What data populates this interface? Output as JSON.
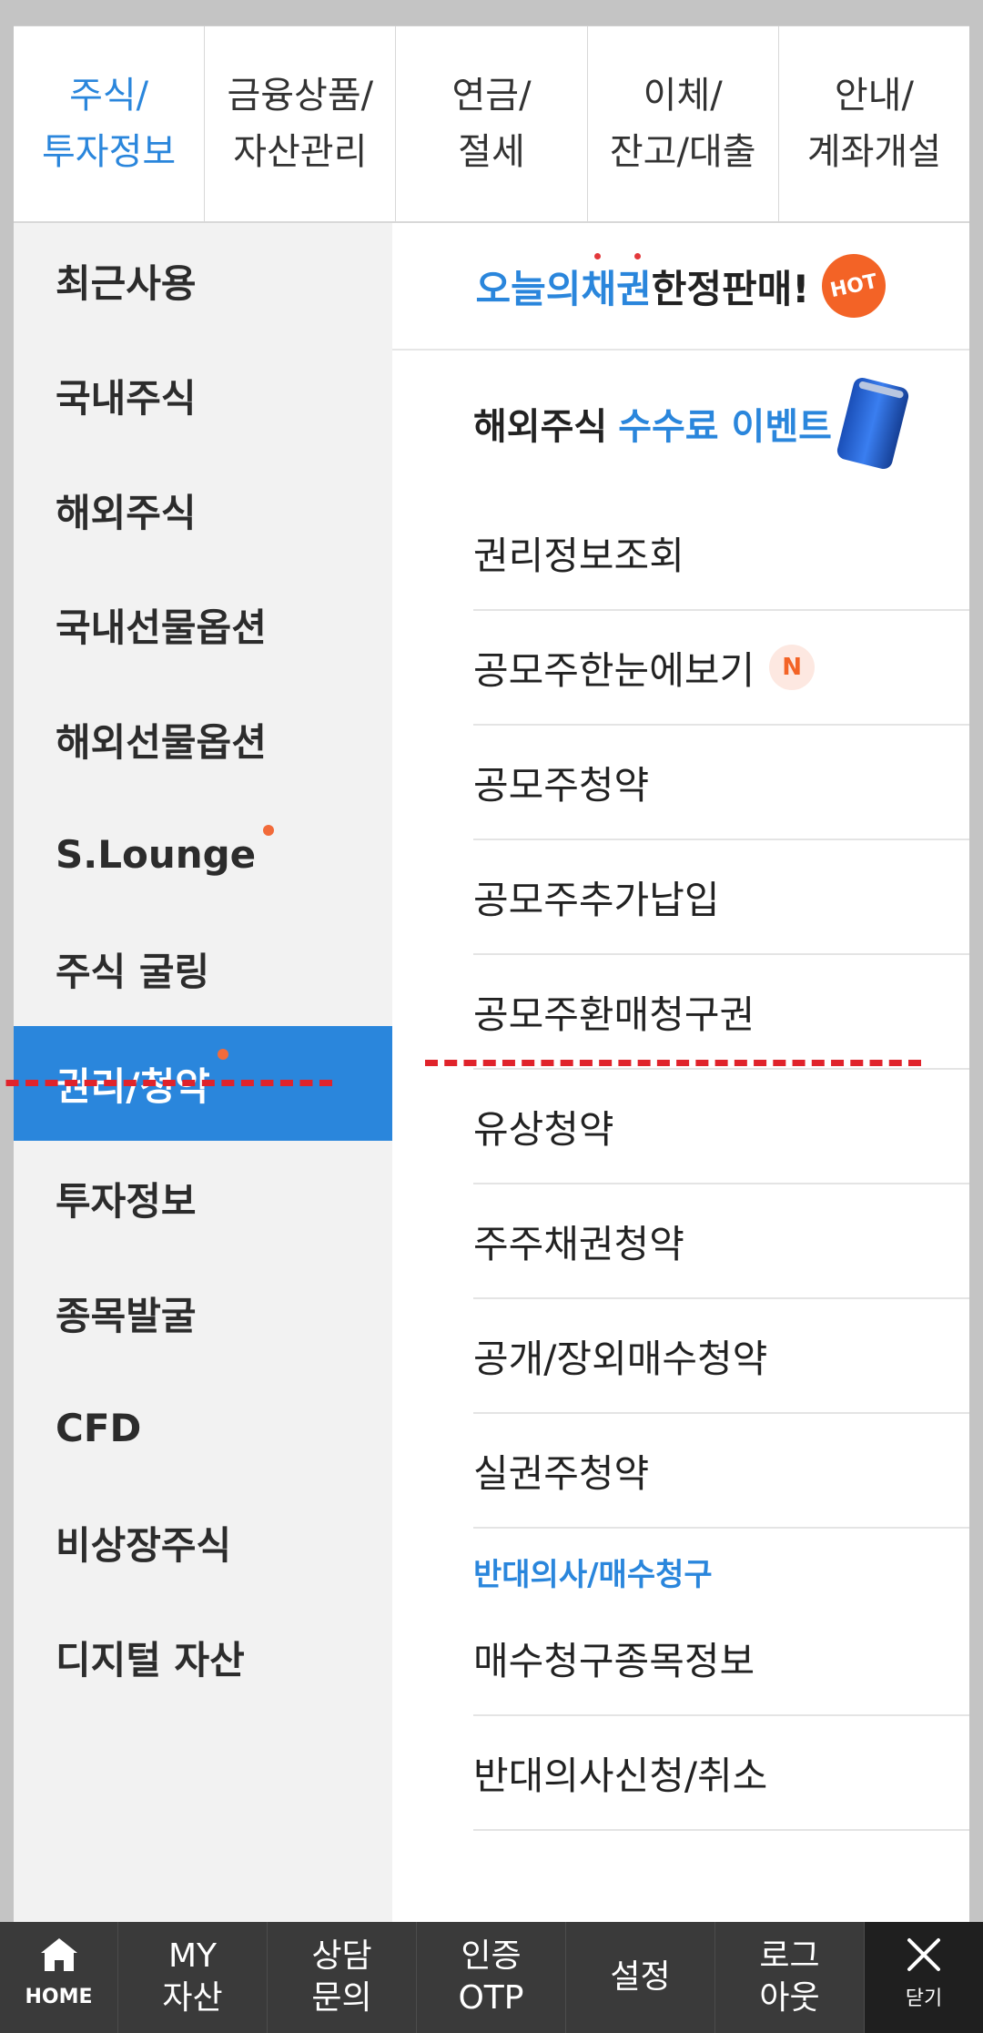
{
  "top_tabs": [
    {
      "line1": "주식/",
      "line2": "투자정보"
    },
    {
      "line1": "금융상품/",
      "line2": "자산관리"
    },
    {
      "line1": "연금/",
      "line2": "절세"
    },
    {
      "line1": "이체/",
      "line2": "잔고/대출"
    },
    {
      "line1": "안내/",
      "line2": "계좌개설"
    }
  ],
  "left_menu": [
    {
      "label": "최근사용"
    },
    {
      "label": "국내주식"
    },
    {
      "label": "해외주식"
    },
    {
      "label": "국내선물옵션"
    },
    {
      "label": "해외선물옵션"
    },
    {
      "label": "S.Lounge"
    },
    {
      "label": "주식 굴링"
    },
    {
      "label": "권리/청약"
    },
    {
      "label": "투자정보"
    },
    {
      "label": "종목발굴"
    },
    {
      "label": "CFD"
    },
    {
      "label": "비상장주식"
    },
    {
      "label": "디지털 자산"
    }
  ],
  "promo1": {
    "blue": "오늘의채권",
    "rest": " 한정판매!",
    "badge": "HOT"
  },
  "promo2": {
    "text": "해외주식",
    "blue": "수수료 이벤트"
  },
  "right_items": [
    {
      "label": "권리정보조회"
    },
    {
      "label": "공모주한눈에보기",
      "badge": "N"
    },
    {
      "label": "공모주청약"
    },
    {
      "label": "공모주추가납입"
    },
    {
      "label": "공모주환매청구권"
    },
    {
      "label": "유상청약"
    },
    {
      "label": "주주채권청약"
    },
    {
      "label": "공개/장외매수청약"
    },
    {
      "label": "실권주청약"
    }
  ],
  "section": {
    "title": "반대의사/매수청구",
    "items": [
      {
        "label": "매수청구종목정보"
      },
      {
        "label": "반대의사신청/취소"
      }
    ]
  },
  "bottom_bar": {
    "home": "HOME",
    "items": [
      {
        "line1": "MY",
        "line2": "자산"
      },
      {
        "line1": "상담",
        "line2": "문의"
      },
      {
        "line1": "인증",
        "line2": "OTP"
      },
      {
        "line1": "설정",
        "line2": ""
      },
      {
        "line1": "로그",
        "line2": "아웃"
      }
    ],
    "close": "닫기"
  },
  "colors": {
    "accent": "#2a86dc",
    "dot": "#f26b3a",
    "bottom_bar": "#3a3a3a",
    "annotation_dash": "#e0232b"
  }
}
